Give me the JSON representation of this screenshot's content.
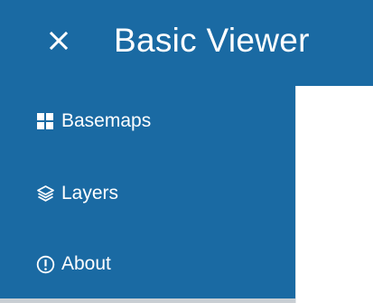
{
  "header": {
    "title": "Basic Viewer",
    "close_icon": "close-icon",
    "background": "#1a6aa3"
  },
  "sidebar": {
    "background": "#1a6aa3",
    "items": [
      {
        "label": "Basemaps",
        "icon": "grid-icon"
      },
      {
        "label": "Layers",
        "icon": "layers-icon"
      },
      {
        "label": "About",
        "icon": "info-icon"
      }
    ]
  }
}
